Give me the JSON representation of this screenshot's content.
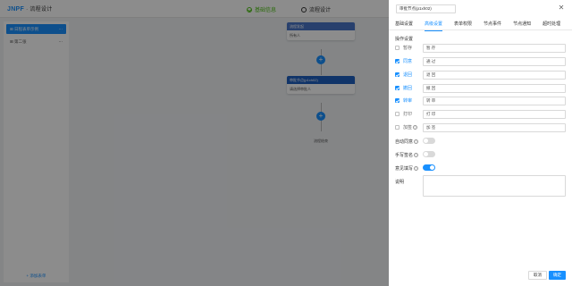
{
  "app": {
    "logo": "JNPF",
    "title": "· 流程设计",
    "steps": [
      {
        "label": "基础信息",
        "done": true
      },
      {
        "label": "流程设计",
        "done": false
      }
    ]
  },
  "leftpanel": {
    "forms": [
      {
        "label": "日程表单示例",
        "active": true
      },
      {
        "label": "第二张"
      }
    ],
    "add_form_label": "+ 添加表单"
  },
  "canvas": {
    "start_node": {
      "title": "流程发起",
      "body": "所有人"
    },
    "approve_node": {
      "title": "审批节点(p1xh02)",
      "body": "请选择审批人"
    },
    "end_label": "流程结束"
  },
  "drawer": {
    "node_name": "审批节点(p1xh02)",
    "tabs": [
      "基础设置",
      "高级设置",
      "表单权限",
      "节点事件",
      "节点通知",
      "超时处理"
    ],
    "active_tab": 1,
    "section_title": "操作设置",
    "operations": [
      {
        "label": "暂存",
        "checked": false,
        "value": "暂 存",
        "help": false
      },
      {
        "label": "同意",
        "checked": true,
        "value": "通 过",
        "help": false
      },
      {
        "label": "退回",
        "checked": true,
        "value": "退 回",
        "help": false
      },
      {
        "label": "撤回",
        "checked": true,
        "value": "撤 回",
        "help": false
      },
      {
        "label": "转审",
        "checked": true,
        "value": "转 审",
        "help": false
      },
      {
        "label": "打印",
        "checked": false,
        "value": "打 印",
        "help": false
      },
      {
        "label": "加签",
        "checked": false,
        "value": "加 签",
        "help": true
      }
    ],
    "switches": [
      {
        "label": "自动同意",
        "on": false
      },
      {
        "label": "手写签名",
        "on": false
      },
      {
        "label": "意见填写",
        "on": true
      }
    ],
    "description_label": "说明",
    "cancel_label": "取消",
    "ok_label": "确定"
  }
}
